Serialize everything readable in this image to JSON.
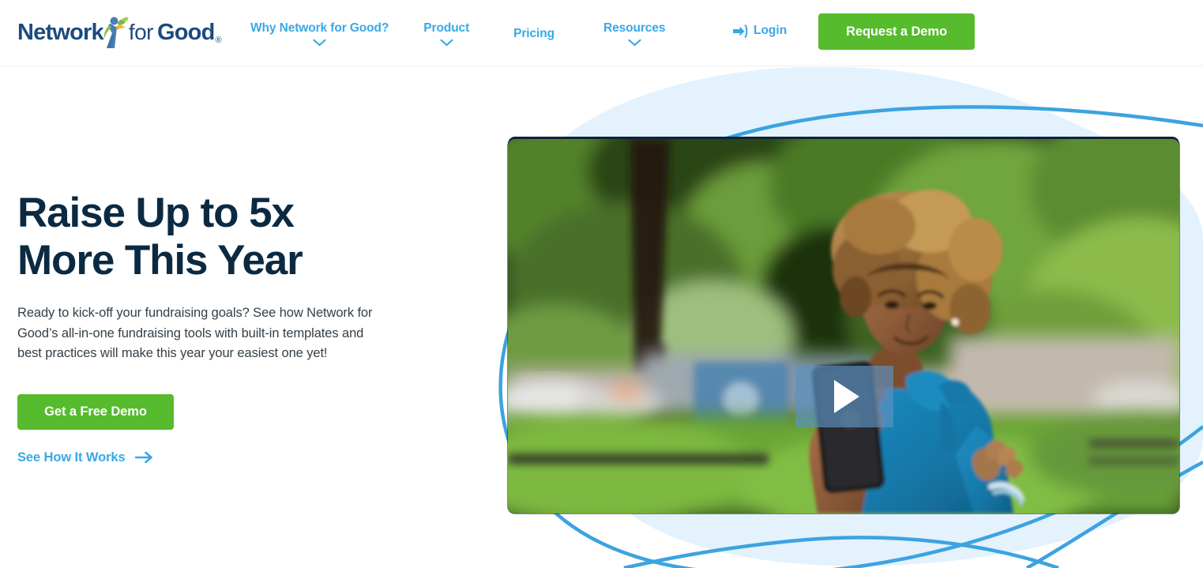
{
  "brand": {
    "logo_text_1": "Network",
    "logo_text_2": "for",
    "logo_text_3": "Good",
    "logo_registered": "®",
    "logo_icon": "person-with-leaves-icon"
  },
  "colors": {
    "nav_blue": "#38a8e8",
    "brand_navy": "#1b4b80",
    "cta_green": "#56bb2d",
    "headline_navy": "#0b2a42",
    "body_gray": "#333f48",
    "blob_light_blue": "#e3f2fc",
    "arc_blue": "#3ca3e0"
  },
  "header": {
    "nav": [
      {
        "label": "Why Network for Good?",
        "has_chevron": true
      },
      {
        "label": "Product",
        "has_chevron": true
      },
      {
        "label": "Pricing",
        "has_chevron": false
      },
      {
        "label": "Resources",
        "has_chevron": true
      }
    ],
    "login_label": "Login",
    "login_icon": "sign-in-icon",
    "demo_button_label": "Request a Demo"
  },
  "hero": {
    "title": "Raise Up to 5x\nMore This Year",
    "subtitle": "Ready to kick-off your fundraising goals? See how Network for Good’s all-in-one fundraising tools with built-in templates and best practices will make this year your easiest one yet!",
    "primary_cta_label": "Get a Free Demo",
    "secondary_link_label": "See How It Works",
    "secondary_link_icon": "arrow-right-icon",
    "video": {
      "play_icon": "play-icon",
      "alt": "Woman in blue top recording a video on her smartphone in a green park"
    }
  }
}
